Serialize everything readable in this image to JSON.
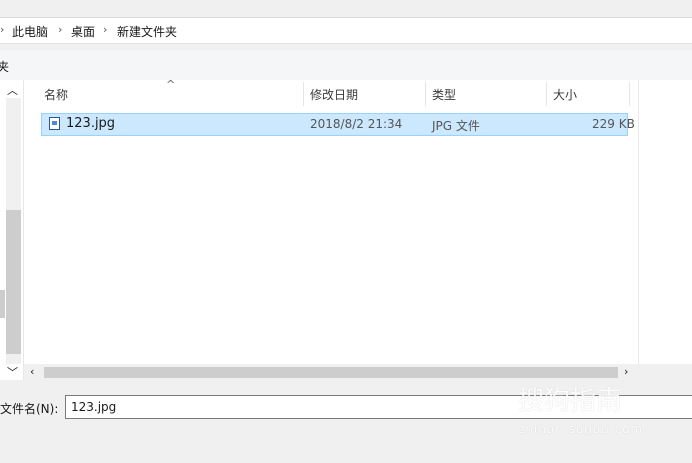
{
  "breadcrumb": {
    "items": [
      "此电脑",
      "桌面",
      "新建文件夹"
    ]
  },
  "toolbar": {
    "partial_label": "夹"
  },
  "columns": {
    "name": "名称",
    "modified": "修改日期",
    "type": "类型",
    "size": "大小"
  },
  "files": [
    {
      "name": "123.jpg",
      "modified": "2018/8/2 21:34",
      "type": "JPG 文件",
      "size": "229 KB",
      "selected": true
    }
  ],
  "filename": {
    "label": "文件名(N):",
    "value": "123.jpg"
  },
  "watermark": {
    "text": "搜狗指南",
    "sub": "zhinan.sogou.com"
  },
  "colors": {
    "selection_bg": "#cce8ff",
    "selection_border": "#99d1ff"
  }
}
